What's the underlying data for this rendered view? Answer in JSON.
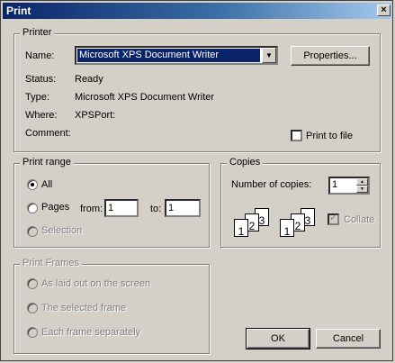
{
  "window": {
    "title": "Print",
    "close_glyph": "×"
  },
  "printer": {
    "legend": "Printer",
    "name_label": "Name:",
    "name_value": "Microsoft XPS Document Writer",
    "properties_label": "Properties...",
    "status_label": "Status:",
    "status_value": "Ready",
    "type_label": "Type:",
    "type_value": "Microsoft XPS Document Writer",
    "where_label": "Where:",
    "where_value": "XPSPort:",
    "comment_label": "Comment:",
    "print_to_file_label": "Print to file"
  },
  "print_range": {
    "legend": "Print range",
    "all_label": "All",
    "pages_label": "Pages",
    "from_label": "from:",
    "from_value": "1",
    "to_label": "to:",
    "to_value": "1",
    "selection_label": "Selection"
  },
  "copies": {
    "legend": "Copies",
    "number_label": "Number of copies:",
    "number_value": "1",
    "collate_label": "Collate",
    "collate_checked": true
  },
  "print_frames": {
    "legend": "Print Frames",
    "opt1": "As laid out on the screen",
    "opt2": "The selected frame",
    "opt3": "Each frame separately"
  },
  "buttons": {
    "ok": "OK",
    "cancel": "Cancel"
  },
  "icons": {
    "close": "close-icon",
    "dropdown": "chevron-down-icon",
    "spin_up": "arrow-up-icon",
    "spin_down": "arrow-down-icon"
  }
}
